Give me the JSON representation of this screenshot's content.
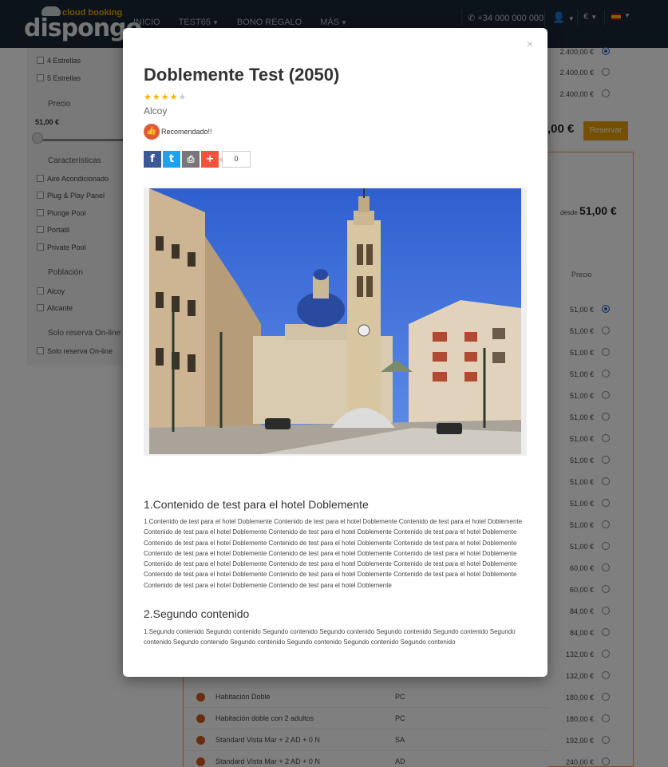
{
  "navbar": {
    "logo_top": "cloud booking",
    "logo_brand": "dispongo",
    "menu": [
      {
        "label": "INICIO",
        "dropdown": false
      },
      {
        "label": "TEST65",
        "dropdown": true
      },
      {
        "label": "BONO REGALO",
        "dropdown": false
      },
      {
        "label": "MÁS",
        "dropdown": true
      }
    ],
    "phone": "+34 000 000 000",
    "currency": "€",
    "user_icon": "user-icon",
    "language_flag": "spain-flag-icon"
  },
  "sidebar": {
    "stars_options": [
      "4 Estrellas",
      "5 Estrellas"
    ],
    "price_label": "Precio",
    "price_min": "51,00 €",
    "features_label": "Características",
    "features": [
      "Aire Acondicionado",
      "Plug & Play Panel",
      "Plunge Pool",
      "Portatil",
      "Private Pool"
    ],
    "population_label": "Población",
    "population": [
      "Alcoy",
      "Alicante"
    ],
    "online_label": "Solo reserva On-line",
    "online_option": "Solo reserva On-line"
  },
  "right_col": {
    "prices_top": [
      "2.400,00 €",
      "2.400,00 €",
      "2.400,00 €"
    ],
    "total_price": ",00 €",
    "reserve_label": "Reservar",
    "desde_label": "desde",
    "desde_price": "51,00 €",
    "precio_header": "Precio",
    "prices": [
      "51,00 €",
      "51,00 €",
      "51,00 €",
      "51,00 €",
      "51,00 €",
      "51,00 €",
      "51,00 €",
      "51,00 €",
      "51,00 €",
      "51,00 €",
      "51,00 €",
      "51,00 €",
      "60,00 €",
      "60,00 €",
      "84,00 €",
      "84,00 €",
      "132,00 €",
      "132,00 €",
      "180,00 €",
      "180,00 €",
      "192,00 €",
      "240,00 €"
    ]
  },
  "rooms": [
    {
      "name": "Habitación Doble",
      "code": "PC"
    },
    {
      "name": "Habitación doble con 2 adultos",
      "code": "PC"
    },
    {
      "name": "Standard Vista Mar + 2 AD + 0 N",
      "code": "SA"
    },
    {
      "name": "Standard Vista Mar + 2 AD + 0 N",
      "code": "AD"
    }
  ],
  "modal": {
    "close": "×",
    "title": "Doblemente Test (2050)",
    "stars_filled": 4,
    "stars_total": 5,
    "city": "Alcoy",
    "recommended": "Recomendado!!",
    "share_count": "0",
    "section1_title": "1.Contenido de test para el hotel Doblemente",
    "section1_text": "1.Contenido de test para el hotel Doblemente Contenido de test para el hotel Doblemente Contenido de test para el hotel Doblemente Contenido de test para el hotel Doblemente Contenido de test para el hotel Doblemente Contenido de test para el hotel Doblemente Contenido de test para el hotel Doblemente Contenido de test para el hotel Doblemente Contenido de test para el hotel Doblemente Contenido de test para el hotel Doblemente Contenido de test para el hotel Doblemente Contenido de test para el hotel Doblemente Contenido de test para el hotel Doblemente Contenido de test para el hotel Doblemente Contenido de test para el hotel Doblemente Contenido de test para el hotel Doblemente Contenido de test para el hotel Doblemente Contenido de test para el hotel Doblemente Contenido de test para el hotel Doblemente Contenido de test para el hotel Doblemente",
    "section2_title": "2.Segundo contenido",
    "section2_text": "1.Segundo contenido Segundo contenido Segundo contenido Segundo contenido Segundo contenido Segundo contenido Segundo contenido Segundo contenido Segundo contenido Segundo contenido Segundo contenido Segundo contenido"
  },
  "colors": {
    "navbar_bg": "#1b2634",
    "accent": "#e8a100",
    "star": "#f4b400",
    "recommend": "#e05a3a"
  }
}
